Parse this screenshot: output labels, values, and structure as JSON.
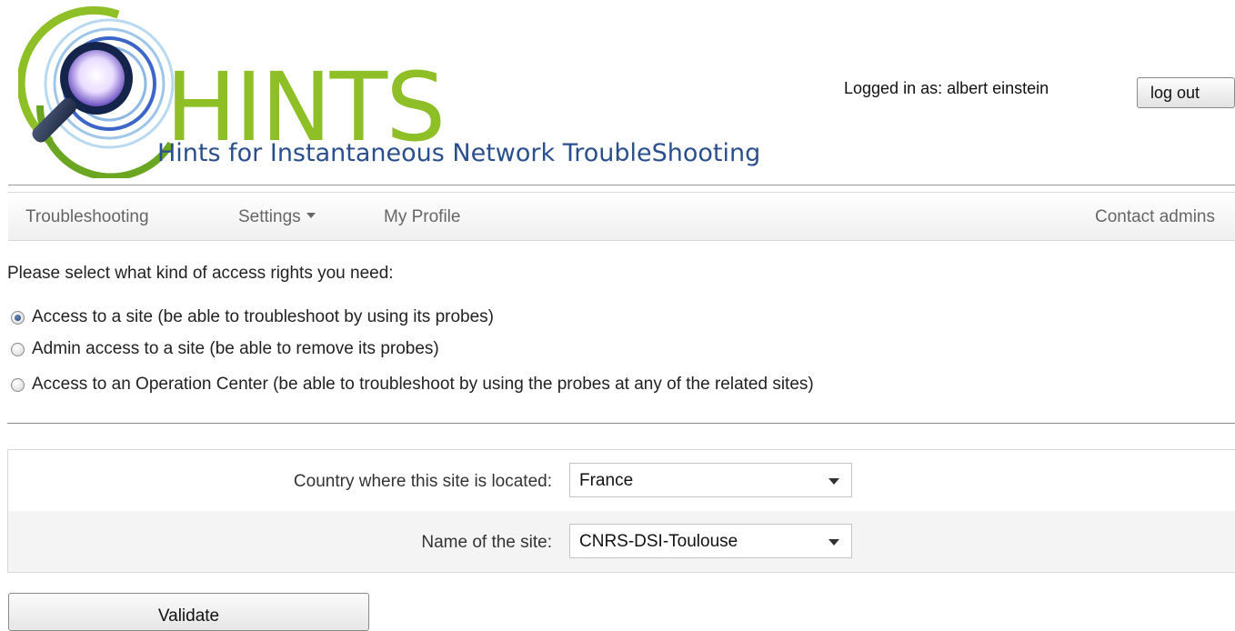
{
  "header": {
    "logo_word": "HINTS",
    "tagline": "Hints for Instantaneous Network TroubleShooting",
    "login_text": "Logged in as: albert einstein",
    "logout_label": "log out"
  },
  "nav": {
    "items": [
      {
        "label": "Troubleshooting"
      },
      {
        "label": "Settings",
        "has_dropdown": true
      },
      {
        "label": "My Profile"
      }
    ],
    "right_item": "Contact admins"
  },
  "access": {
    "prompt": "Please select what kind of access rights you need:",
    "options": [
      {
        "label": "Access to a site (be able to troubleshoot by using its probes)",
        "checked": true
      },
      {
        "label": "Admin access to a site (be able to remove its probes)",
        "checked": false
      },
      {
        "label": "Access to an Operation Center (be able to troubleshoot by using the probes at any of the related sites)",
        "checked": false
      }
    ]
  },
  "form": {
    "country_label": "Country where this site is located:",
    "country_value": "France",
    "site_label": "Name of the site:",
    "site_value": "CNRS-DSI-Toulouse"
  },
  "actions": {
    "validate_label": "Validate"
  },
  "colors": {
    "logo_green": "#8ebf26",
    "logo_blue": "#2b4f8c",
    "nav_text": "#666666"
  }
}
